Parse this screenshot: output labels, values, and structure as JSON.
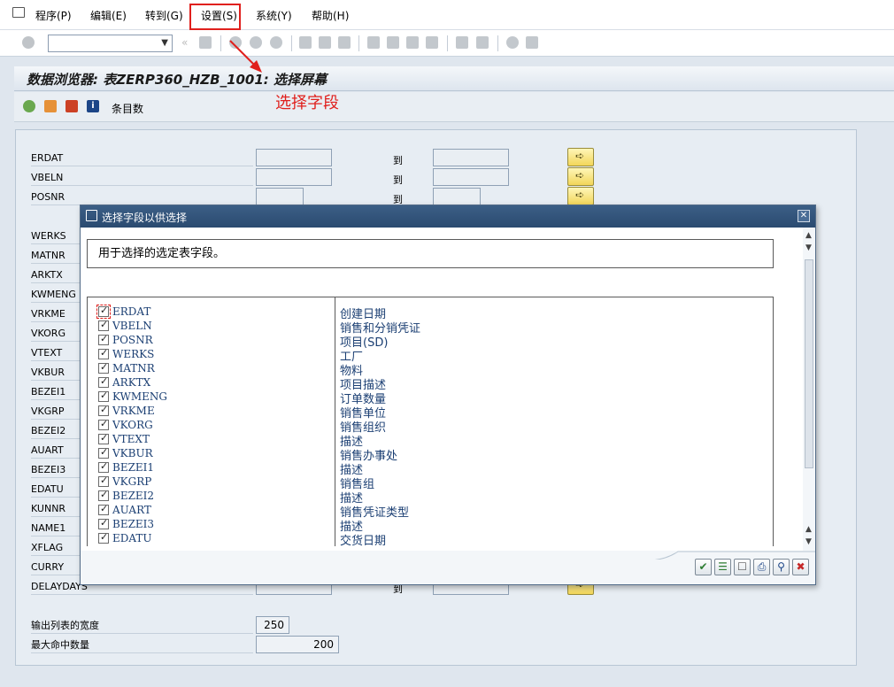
{
  "menu": {
    "items": [
      {
        "label": "程序(P)",
        "key": "P"
      },
      {
        "label": "编辑(E)",
        "key": "E"
      },
      {
        "label": "转到(G)",
        "key": "G"
      },
      {
        "label": "设置(S)",
        "key": "S"
      },
      {
        "label": "系统(Y)",
        "key": "Y"
      },
      {
        "label": "帮助(H)",
        "key": "H"
      }
    ]
  },
  "toolbar": {
    "command_field_value": "",
    "icons": [
      "enter-icon",
      "save-icon",
      "back-icon",
      "exit-icon",
      "cancel-icon",
      "print-icon",
      "find-icon",
      "find-next-icon",
      "first-page-icon",
      "previous-page-icon",
      "next-page-icon",
      "last-page-icon",
      "create-session-icon",
      "shortcut-icon",
      "help-icon",
      "customize-layout-icon"
    ]
  },
  "screen": {
    "title": "数据浏览器: 表ZERP360_HZB_1001: 选择屏幕",
    "appbar_label": "条目数"
  },
  "annotation": {
    "text": "选择字段",
    "color": "#e0201d"
  },
  "selection_fields": [
    {
      "name": "ERDAT",
      "to_label": "到"
    },
    {
      "name": "VBELN",
      "to_label": "到"
    },
    {
      "name": "POSNR",
      "to_label": "到"
    },
    {
      "name": "WERKS"
    },
    {
      "name": "MATNR"
    },
    {
      "name": "ARKTX"
    },
    {
      "name": "KWMENG"
    },
    {
      "name": "VRKME"
    },
    {
      "name": "VKORG"
    },
    {
      "name": "VTEXT"
    },
    {
      "name": "VKBUR"
    },
    {
      "name": "BEZEI1"
    },
    {
      "name": "VKGRP"
    },
    {
      "name": "BEZEI2"
    },
    {
      "name": "AUART"
    },
    {
      "name": "BEZEI3"
    },
    {
      "name": "EDATU"
    },
    {
      "name": "KUNNR"
    },
    {
      "name": "NAME1"
    },
    {
      "name": "XFLAG"
    },
    {
      "name": "CURRY"
    },
    {
      "name": "DELAYDAYS",
      "to_label": "到"
    }
  ],
  "output": {
    "width_label": "输出列表的宽度",
    "width_value": "250",
    "max_hits_label": "最大命中数量",
    "max_hits_value": "200"
  },
  "dialog": {
    "title": "选择字段以供选择",
    "info": "用于选择的选定表字段。",
    "rows": [
      {
        "field": "ERDAT",
        "desc": "创建日期",
        "checked": true
      },
      {
        "field": "VBELN",
        "desc": "销售和分销凭证",
        "checked": true
      },
      {
        "field": "POSNR",
        "desc": "项目(SD)",
        "checked": true
      },
      {
        "field": "WERKS",
        "desc": "工厂",
        "checked": true
      },
      {
        "field": "MATNR",
        "desc": "物料",
        "checked": true
      },
      {
        "field": "ARKTX",
        "desc": "项目描述",
        "checked": true
      },
      {
        "field": "KWMENG",
        "desc": "订单数量",
        "checked": true
      },
      {
        "field": "VRKME",
        "desc": "销售单位",
        "checked": true
      },
      {
        "field": "VKORG",
        "desc": "销售组织",
        "checked": true
      },
      {
        "field": "VTEXT",
        "desc": "描述",
        "checked": true
      },
      {
        "field": "VKBUR",
        "desc": "销售办事处",
        "checked": true
      },
      {
        "field": "BEZEI1",
        "desc": "描述",
        "checked": true
      },
      {
        "field": "VKGRP",
        "desc": "销售组",
        "checked": true
      },
      {
        "field": "BEZEI2",
        "desc": "描述",
        "checked": true
      },
      {
        "field": "AUART",
        "desc": "销售凭证类型",
        "checked": true
      },
      {
        "field": "BEZEI3",
        "desc": "描述",
        "checked": true
      },
      {
        "field": "EDATU",
        "desc": "交货日期",
        "checked": true
      }
    ],
    "footer_buttons": [
      "confirm-icon",
      "select-all-icon",
      "deselect-all-icon",
      "print-icon",
      "find-icon",
      "cancel-icon"
    ]
  }
}
